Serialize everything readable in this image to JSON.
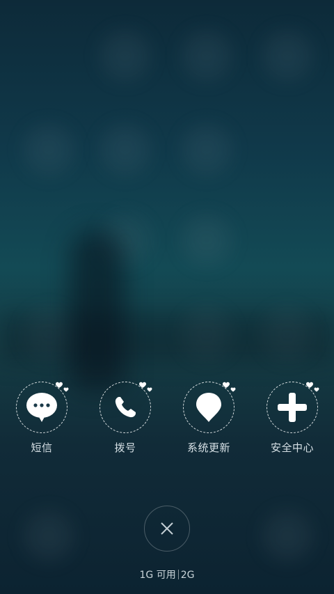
{
  "actions": [
    {
      "label": "短信",
      "icon": "message-icon"
    },
    {
      "label": "拨号",
      "icon": "phone-icon"
    },
    {
      "label": "系统更新",
      "icon": "update-drop-icon"
    },
    {
      "label": "安全中心",
      "icon": "plus-icon"
    }
  ],
  "close_icon": "close-icon",
  "memory": {
    "available": "1G 可用",
    "total": "2G"
  },
  "colors": {
    "background_top": "#0d2a39",
    "background_mid": "#134a55",
    "background_bottom": "#0c2331",
    "icon_white": "#ffffff",
    "label_text": "#d6e0e5"
  }
}
